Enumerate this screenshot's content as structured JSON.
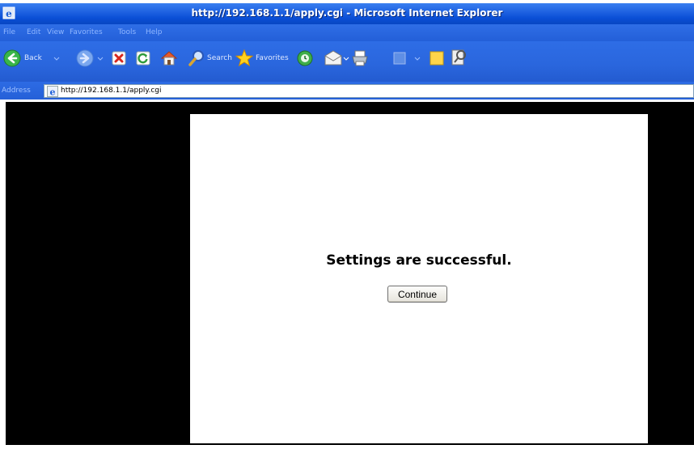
{
  "window": {
    "title": "http://192.168.1.1/apply.cgi - Microsoft Internet Explorer"
  },
  "menu": {
    "items": [
      "File",
      "Edit",
      "View",
      "Favorites",
      "Tools",
      "Help"
    ]
  },
  "toolbar": {
    "back_label": "Back",
    "search_label": "Search",
    "favorites_label": "Favorites"
  },
  "address": {
    "label": "Address",
    "url": "http://192.168.1.1/apply.cgi"
  },
  "page": {
    "message": "Settings are successful.",
    "continue_label": "Continue"
  },
  "colors": {
    "titlebar": "#0a4fd6",
    "page_background": "#000000",
    "panel_background": "#ffffff"
  }
}
